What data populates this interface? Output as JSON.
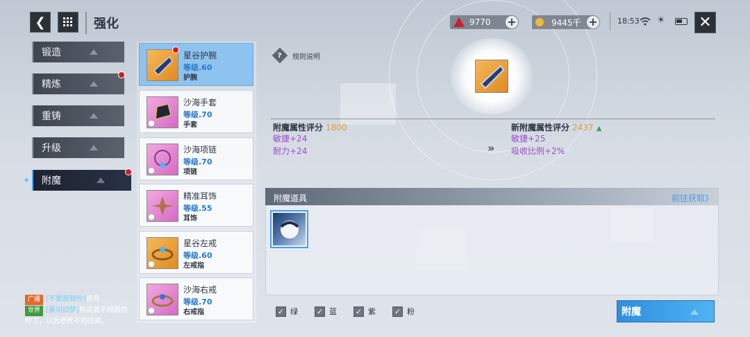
{
  "header": {
    "title": "强化",
    "currency_a": "9770",
    "currency_b": "9445千",
    "time": "18:53"
  },
  "nav": {
    "items": [
      {
        "label": "锻造"
      },
      {
        "label": "精炼"
      },
      {
        "label": "重铸"
      },
      {
        "label": "升级"
      },
      {
        "label": "附魔"
      }
    ]
  },
  "items": [
    {
      "name": "星谷护腕",
      "level": "等级.60",
      "type": "护腕"
    },
    {
      "name": "沙海手套",
      "level": "等级.70",
      "type": "手套"
    },
    {
      "name": "沙海项链",
      "level": "等级.70",
      "type": "项链"
    },
    {
      "name": "精准耳饰",
      "level": "等级.55",
      "type": "耳饰"
    },
    {
      "name": "星谷左戒",
      "level": "等级.60",
      "type": "左戒指"
    },
    {
      "name": "沙海右戒",
      "level": "等级.70",
      "type": "右戒指"
    }
  ],
  "rules": {
    "label": "规则说明"
  },
  "current": {
    "title": "附魔属性评分",
    "score": "1800",
    "lines": [
      "敏捷+24",
      "耐力+24"
    ]
  },
  "next": {
    "title": "新附魔属性评分",
    "score": "2437",
    "lines": [
      "敏捷+25",
      "吸收比例+2%"
    ]
  },
  "materials": {
    "title": "附魔道具",
    "link": "前往获取》"
  },
  "filters": [
    "绿",
    "蓝",
    "紫",
    "粉"
  ],
  "enchant_button": "附魔",
  "chat": {
    "broadcast_tag": "广播",
    "broadcast_name": "[不要跟我吵]",
    "broadcast_text": "月月",
    "world_tag": "世界",
    "world_name": "[墨羽旧梦]",
    "world_text": "狗县我不想跟你吵了，以后老死不相往来。"
  },
  "colors": {
    "accent_blue": "#4a9ee6",
    "notify_red": "#d21a26",
    "score_gold": "#d6a03a",
    "attr_purple": "#9a4cc7"
  }
}
